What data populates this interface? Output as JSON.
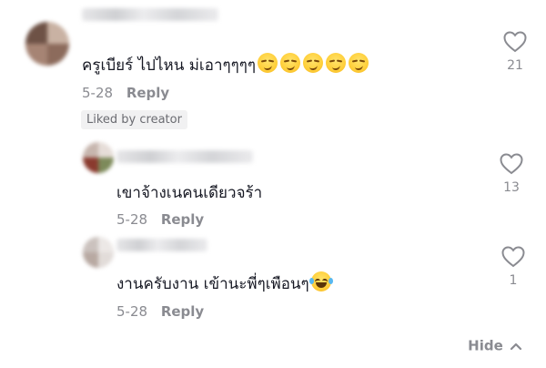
{
  "comments": [
    {
      "text": "ครูเบียร์ ไปไหน ม่เอาๆๆๆๆ",
      "emojis": [
        "smirking-face-emoji",
        "smirking-face-emoji",
        "smirking-face-emoji",
        "smirking-face-emoji",
        "smirking-face-emoji"
      ],
      "date": "5-28",
      "reply": "Reply",
      "liked_badge": "Liked by creator",
      "likes": "21"
    },
    {
      "text": "เขาจ้างเนคนเดียวจร้า",
      "date": "5-28",
      "reply": "Reply",
      "likes": "13"
    },
    {
      "text": "งานครับงาน เข้านะพี่ๆเพือนๆ",
      "emojis": [
        "face-with-tears-of-joy-emoji"
      ],
      "date": "5-28",
      "reply": "Reply",
      "likes": "1"
    }
  ],
  "hide_label": "Hide",
  "colors": {
    "text": "#161823",
    "muted": "#8a8b91",
    "badge_bg": "#f1f1f2"
  }
}
